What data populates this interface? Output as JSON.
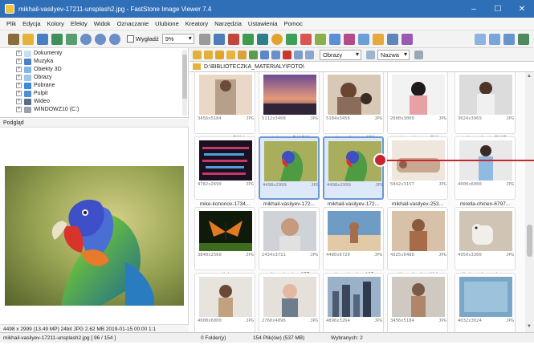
{
  "window": {
    "title": "mikhail-vasilyev-17211-unsplash2.jpg - FastStone Image Viewer 7.4",
    "controls": [
      "–",
      "☐",
      "✕"
    ]
  },
  "menu": [
    "Plik",
    "Edycja",
    "Kolory",
    "Efekty",
    "Widok",
    "Oznaczanie",
    "Ulubione",
    "Kreatory",
    "Narzędzia",
    "Ustawienia",
    "Pomoc"
  ],
  "toolbar": {
    "checkbox_label": "Wygładź",
    "zoom_value": "9%"
  },
  "tree": {
    "items": [
      {
        "label": "Dokumenty"
      },
      {
        "label": "Muzyka"
      },
      {
        "label": "Obiekty 3D"
      },
      {
        "label": "Obrazy"
      },
      {
        "label": "Pobrane"
      },
      {
        "label": "Pulpit"
      },
      {
        "label": "Wideo"
      },
      {
        "label": "WINDOWZ10 (C:)"
      }
    ]
  },
  "preview": {
    "label": "Podgląd",
    "info": "4498 x 2999 (13.49 MP)  24bit  JPG  2.62 MB  2019-01-15 00:00  1:1"
  },
  "address": {
    "path": "D:\\BIBLIOTECZKA_MATERIALY\\FOTO\\",
    "filter_value": "Obrazy",
    "sort_value": "Nazwa"
  },
  "thumbnails": [
    {
      "dims": "3456x5184",
      "type": "JPG",
      "name": "marco-gaspar-7834-..."
    },
    {
      "dims": "5112x3408",
      "type": "JPG",
      "name": "mark-kagan-748500..."
    },
    {
      "dims": "5184x3456",
      "type": "JPG",
      "name": "matheus-ferrero-353..."
    },
    {
      "dims": "2000x3000",
      "type": "JPG",
      "name": "matheus-ferrero-739..."
    },
    {
      "dims": "3024x3969",
      "type": "JPG",
      "name": "matheus-frade-7697..."
    },
    {
      "dims": "4782x2690",
      "type": "JPG",
      "name": "mike-kononov-1734..."
    },
    {
      "dims": "4498x2999",
      "type": "JPG",
      "name": "mikhail-vasilyev-172..."
    },
    {
      "dims": "4498x2999",
      "type": "JPG",
      "name": "mikhail-vasilyev-172..."
    },
    {
      "dims": "5842x3157",
      "type": "JPG",
      "name": "mikhail-vasilyev-253..."
    },
    {
      "dims": "4000x6000",
      "type": "JPG",
      "name": "mirella-chinen-6797..."
    },
    {
      "dims": "3840x2560",
      "type": "JPG",
      "name": "moth.jpg"
    },
    {
      "dims": "2434x3711",
      "type": "JPG",
      "name": "nathan-dumlao-357..."
    },
    {
      "dims": "4480x6720",
      "type": "JPG",
      "name": "nathan-dumlao-135..."
    },
    {
      "dims": "4325x6488",
      "type": "JPG",
      "name": "nathan-dumlao-114..."
    },
    {
      "dims": "4950x3300",
      "type": "JPG",
      "name": "nikolay-tchaouchev-..."
    },
    {
      "dims": "4000x6000",
      "type": "JPG",
      "name": ""
    },
    {
      "dims": "2760x4896",
      "type": "JPG",
      "name": ""
    },
    {
      "dims": "4896x3264",
      "type": "JPG",
      "name": ""
    },
    {
      "dims": "3456x5184",
      "type": "JPG",
      "name": ""
    },
    {
      "dims": "4032x3024",
      "type": "JPG",
      "name": ""
    }
  ],
  "status": {
    "file": "mikhail-vasilyev-17211-unsplash2.jpg [ 96 / 154 ]",
    "folders": "0 Folder(y)",
    "files": "154 Plik(ów) (537 MB)",
    "selected": "Wybranych: 2"
  },
  "colors": {
    "titlebar": "#2f6fb7",
    "selection_border": "#6e98d3",
    "callout": "#c7262e"
  }
}
